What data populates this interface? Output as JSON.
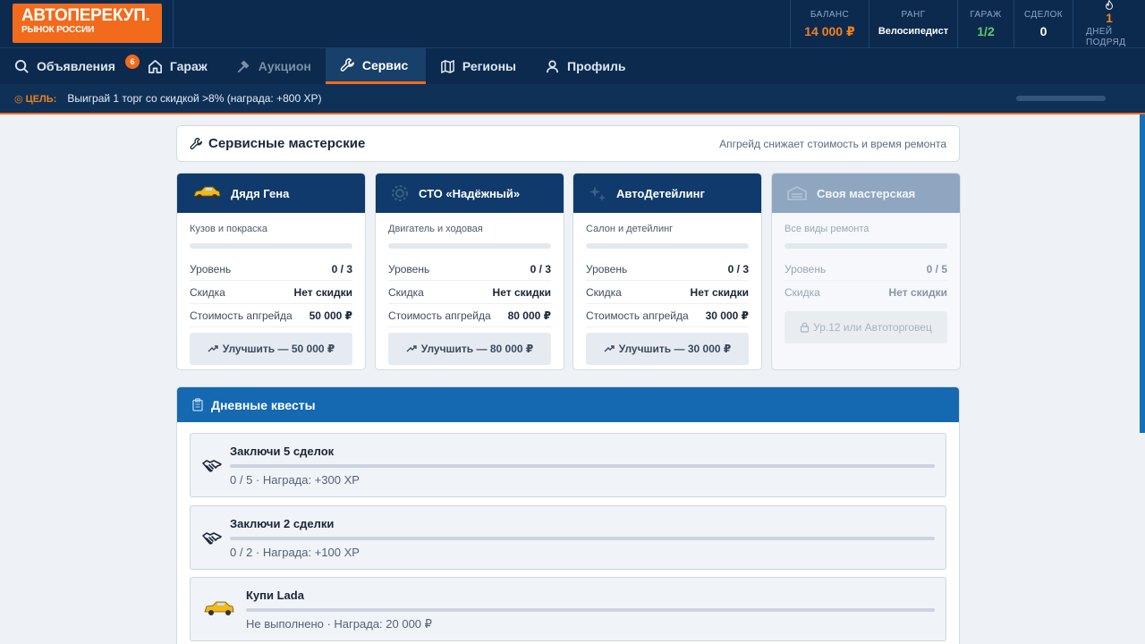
{
  "header": {
    "logo_title": "АВТОПЕРЕКУП.",
    "logo_subtitle": "РЫНОК РОССИИ",
    "stats": {
      "balance_label": "БАЛАНС",
      "balance_value": "14 000 ₽",
      "rank_label": "РАНГ",
      "rank_value": "Велосипедист",
      "garage_label": "ГАРАЖ",
      "garage_value": "1/2",
      "deals_label": "СДЕЛОК",
      "deals_value": "0",
      "days_value": "1",
      "days_label": "ДНЕЙ ПОДРЯД"
    }
  },
  "nav": {
    "items": [
      {
        "label": "Объявления",
        "icon": "search-icon"
      },
      {
        "label": "Гараж",
        "icon": "house-icon"
      },
      {
        "label": "Аукцион",
        "icon": "gavel-icon"
      },
      {
        "label": "Сервис",
        "icon": "wrench-icon"
      },
      {
        "label": "Регионы",
        "icon": "map-icon"
      },
      {
        "label": "Профиль",
        "icon": "user-icon"
      }
    ],
    "ads_badge": "6",
    "active": "Сервис"
  },
  "goal": {
    "label": "ЦЕЛЬ:",
    "text": "Выиграй 1 торг со скидкой >8% (награда: +800 XP)",
    "progress": 0
  },
  "service": {
    "title": "Сервисные мастерские",
    "hint": "Апгрейд снижает стоимость и время ремонта",
    "level_label": "Уровень",
    "discount_label": "Скидка",
    "cost_label": "Стоимость апгрейда",
    "shops": [
      {
        "name": "Дядя Гена",
        "icon": "taxi-car-icon",
        "specialty": "Кузов и покраска",
        "level": "0 / 3",
        "discount": "Нет скидки",
        "cost": "50 000 ₽",
        "button": "Улучшить — 50 000 ₽"
      },
      {
        "name": "СТО «Надёжный»",
        "icon": "gear-icon",
        "specialty": "Двигатель и ходовая",
        "level": "0 / 3",
        "discount": "Нет скидки",
        "cost": "80 000 ₽",
        "button": "Улучшить — 80 000 ₽"
      },
      {
        "name": "АвтоДетейлинг",
        "icon": "sparkles-icon",
        "specialty": "Салон и детейлинг",
        "level": "0 / 3",
        "discount": "Нет скидки",
        "cost": "30 000 ₽",
        "button": "Улучшить — 30 000 ₽"
      },
      {
        "name": "Своя мастерская",
        "icon": "garage-icon",
        "specialty": "Все виды ремонта",
        "level": "0 / 5",
        "discount": "Нет скидки",
        "button": "Ур.12 или Автоторговец"
      }
    ]
  },
  "quests": {
    "title": "Дневные квесты",
    "items": [
      {
        "title": "Заключи 5 сделок",
        "status": "0 / 5 · Награда: +300 XP",
        "icon": "handshake-icon",
        "progress": 0
      },
      {
        "title": "Заключи 2 сделки",
        "status": "0 / 2 · Награда: +100 XP",
        "icon": "handshake-icon",
        "progress": 0
      },
      {
        "title": "Купи Lada",
        "status": "Не выполнено · Награда: 20 000 ₽",
        "icon": "car-icon",
        "progress": 0
      }
    ]
  },
  "colors": {
    "header_bg": "#0c2a4d",
    "accent": "#f26a1b",
    "card_head": "#0f3a6b",
    "quests_head": "#1469b0"
  }
}
